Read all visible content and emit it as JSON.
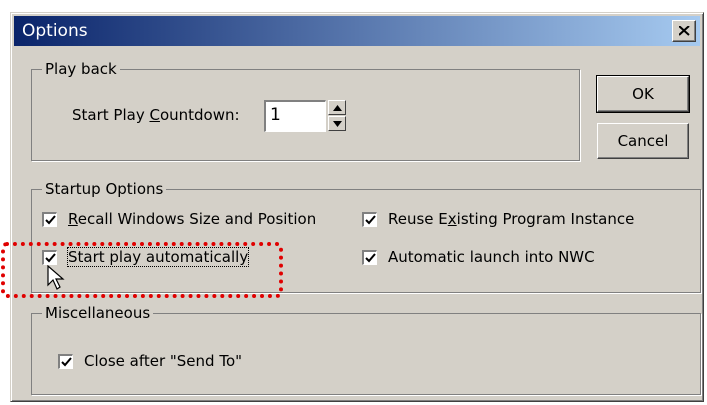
{
  "window": {
    "title": "Options"
  },
  "playback": {
    "legend": "Play back",
    "countdown_label_pre": "Start Play ",
    "countdown_label_underline": "C",
    "countdown_label_post": "ountdown:",
    "countdown_value": "1"
  },
  "buttons": {
    "ok": "OK",
    "cancel": "Cancel"
  },
  "startup": {
    "legend": "Startup Options",
    "recall": {
      "u": "R",
      "rest": "ecall Windows Size and Position",
      "checked": true
    },
    "start_play": {
      "label": "Start play automatically",
      "checked": true
    },
    "reuse": {
      "pre": "Reuse E",
      "u": "x",
      "rest": "isting Program Instance",
      "checked": true
    },
    "auto_launch": {
      "label": "Automatic launch into NWC",
      "checked": true
    }
  },
  "misc": {
    "legend": "Miscellaneous",
    "close_after": {
      "label": "Close after \"Send To\"",
      "checked": true
    }
  },
  "annotation_color": "#e00000"
}
